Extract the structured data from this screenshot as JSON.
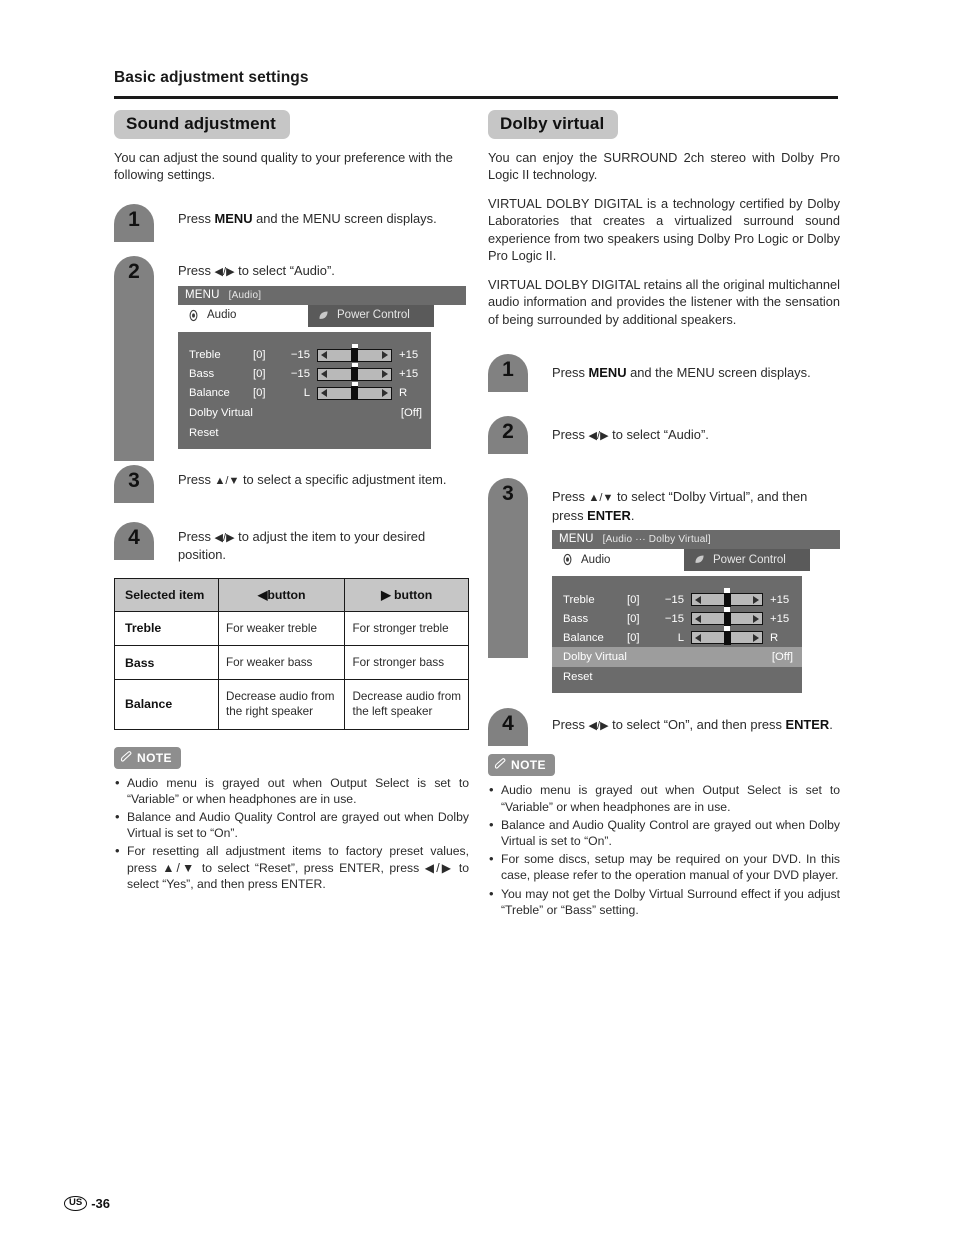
{
  "header": {
    "title": "Basic adjustment settings"
  },
  "footer": {
    "region": "US",
    "page": "-36"
  },
  "left": {
    "section_title": "Sound adjustment",
    "intro": "You can adjust the sound quality to your preference with the following settings.",
    "steps": [
      {
        "num": "1",
        "text_pre": "Press ",
        "bold": "MENU",
        "text_post": " and the MENU screen displays."
      },
      {
        "num": "2",
        "text_pre": "Press ",
        "arrows": "◀/▶",
        "text_post": " to select “Audio”."
      },
      {
        "num": "3",
        "text_pre": "Press ",
        "arrows": "▲/▼",
        "text_post": " to select a specific adjustment item."
      },
      {
        "num": "4",
        "text_pre": "Press ",
        "arrows": "◀/▶",
        "text_post": " to adjust the item to your desired position."
      }
    ],
    "osd": {
      "title_label": "MENU",
      "title_path": "[Audio]",
      "tabs": [
        {
          "label": "Audio",
          "icon": "speaker-icon",
          "selected": true
        },
        {
          "label": "Power Control",
          "icon": "leaf-icon",
          "selected": false
        }
      ],
      "rows": [
        {
          "name": "Treble",
          "value": "[0]",
          "low": "−15",
          "high": "+15",
          "slider": true,
          "pos": 50
        },
        {
          "name": "Bass",
          "value": "[0]",
          "low": "−15",
          "high": "+15",
          "slider": true,
          "pos": 50
        },
        {
          "name": "Balance",
          "value": "[0]",
          "low": "L",
          "high": "R",
          "slider": true,
          "pos": 50
        },
        {
          "name": "Dolby Virtual",
          "value": "[Off]",
          "slider": false,
          "highlight": false
        },
        {
          "name": "Reset",
          "value": "",
          "slider": false,
          "highlight": false
        }
      ]
    },
    "table": {
      "headers": [
        "Selected item",
        "◀button",
        "▶ button"
      ],
      "rows": [
        {
          "item": "Treble",
          "left": "For weaker treble",
          "right": "For stronger treble"
        },
        {
          "item": "Bass",
          "left": "For weaker bass",
          "right": "For stronger bass"
        },
        {
          "item": "Balance",
          "left": "Decrease audio from the right speaker",
          "right": "Decrease audio from the left speaker"
        }
      ]
    },
    "note": {
      "label": "NOTE",
      "items": [
        "Audio menu is grayed out when Output Select is set to “Variable” or when headphones are in use.",
        "Balance and Audio Quality Control are grayed out when Dolby Virtual is set to “On”.",
        "For resetting all adjustment items to factory preset values, press ▲/▼ to select “Reset”, press ENTER, press ◀/▶ to select “Yes”, and then press ENTER."
      ]
    }
  },
  "right": {
    "section_title": "Dolby virtual",
    "paragraphs": [
      "You can enjoy the SURROUND 2ch stereo with Dolby Pro Logic II technology.",
      "VIRTUAL DOLBY DIGITAL is a technology certified by Dolby Laboratories that creates a virtualized surround sound experience from two speakers using Dolby Pro Logic or Dolby Pro Logic II.",
      "VIRTUAL DOLBY DIGITAL retains all the original multichannel audio information and provides the listener with the sensation of being surrounded by additional speakers."
    ],
    "steps": [
      {
        "num": "1",
        "text_pre": "Press ",
        "bold": "MENU",
        "text_post": " and the MENU screen displays."
      },
      {
        "num": "2",
        "text_pre": "Press ",
        "arrows": "◀/▶",
        "text_post": " to select “Audio”."
      },
      {
        "num": "3",
        "text_pre": "Press ",
        "arrows": "▲/▼",
        "text_post": " to select “Dolby Virtual”, and then press ",
        "bold2": "ENTER",
        "text_end": "."
      },
      {
        "num": "4",
        "text_pre": "Press ",
        "arrows": "◀/▶",
        "text_post": " to select “On”, and then press ",
        "bold2": "ENTER",
        "text_end": "."
      }
    ],
    "osd": {
      "title_label": "MENU",
      "title_path": "[Audio ··· Dolby Virtual]",
      "tabs": [
        {
          "label": "Audio",
          "icon": "speaker-icon",
          "selected": true
        },
        {
          "label": "Power Control",
          "icon": "leaf-icon",
          "selected": false
        }
      ],
      "rows": [
        {
          "name": "Treble",
          "value": "[0]",
          "low": "−15",
          "high": "+15",
          "slider": true,
          "pos": 50
        },
        {
          "name": "Bass",
          "value": "[0]",
          "low": "−15",
          "high": "+15",
          "slider": true,
          "pos": 50
        },
        {
          "name": "Balance",
          "value": "[0]",
          "low": "L",
          "high": "R",
          "slider": true,
          "pos": 50
        },
        {
          "name": "Dolby Virtual",
          "value": "[Off]",
          "slider": false,
          "highlight": true
        },
        {
          "name": "Reset",
          "value": "",
          "slider": false,
          "highlight": false
        }
      ]
    },
    "note": {
      "label": "NOTE",
      "items": [
        "Audio menu is grayed out when Output Select is set to “Variable” or when headphones are in use.",
        "Balance and Audio Quality Control are grayed out when Dolby Virtual is set to “On”.",
        "For some discs, setup may be required on your DVD. In this case, please refer to the operation manual of your DVD player.",
        "You may not get the Dolby Virtual Surround effect if you adjust “Treble” or “Bass” setting."
      ]
    }
  }
}
